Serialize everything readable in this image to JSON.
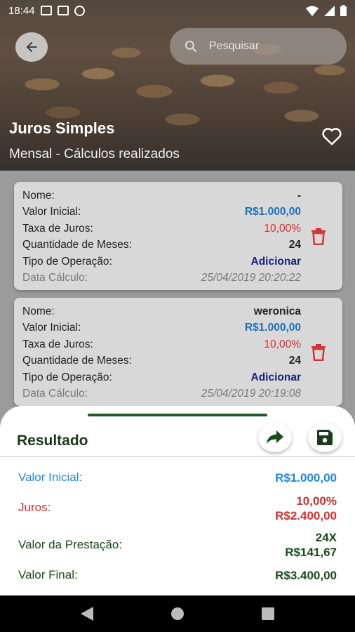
{
  "status_bar": {
    "time": "18:44"
  },
  "header": {
    "search_placeholder": "Pesquisar",
    "title": "Juros Simples",
    "subtitle": "Mensal - Cálculos realizados"
  },
  "cards": [
    {
      "rows": [
        {
          "label": "Nome:",
          "value": "-"
        },
        {
          "label": "Valor Inicial:",
          "value": "R$1.000,00"
        },
        {
          "label": "Taxa de Juros:",
          "value": "10,00%"
        },
        {
          "label": "Quantidade de Meses:",
          "value": "24"
        },
        {
          "label": "Tipo de Operação:",
          "value": "Adicionar"
        },
        {
          "label": "Data Cálculo:",
          "value": "25/04/2019 20:20:22"
        }
      ]
    },
    {
      "rows": [
        {
          "label": "Nome:",
          "value": "weronica"
        },
        {
          "label": "Valor Inicial:",
          "value": "R$1.000,00"
        },
        {
          "label": "Taxa de Juros:",
          "value": "10,00%"
        },
        {
          "label": "Quantidade de Meses:",
          "value": "24"
        },
        {
          "label": "Tipo de Operação:",
          "value": "Adicionar"
        },
        {
          "label": "Data Cálculo:",
          "value": "25/04/2019 20:19:08"
        }
      ]
    }
  ],
  "result": {
    "title": "Resultado",
    "valor_inicial_label": "Valor Inicial:",
    "valor_inicial": "R$1.000,00",
    "juros_label": "Juros:",
    "juros_rate": "10,00%",
    "juros_value": "R$2.400,00",
    "prestacao_label": "Valor da Prestação:",
    "prestacao_count": "24X",
    "prestacao_value": "R$141,67",
    "final_label": "Valor Final:",
    "final_value": "R$3.400,00"
  },
  "colors": {
    "blue": "#1e88e5",
    "red": "#d32f2f",
    "green": "#1b4d1b",
    "navy": "#1a237e"
  },
  "icons": [
    "back-arrow-icon",
    "search-icon",
    "heart-icon",
    "trash-icon",
    "share-icon",
    "save-icon"
  ]
}
